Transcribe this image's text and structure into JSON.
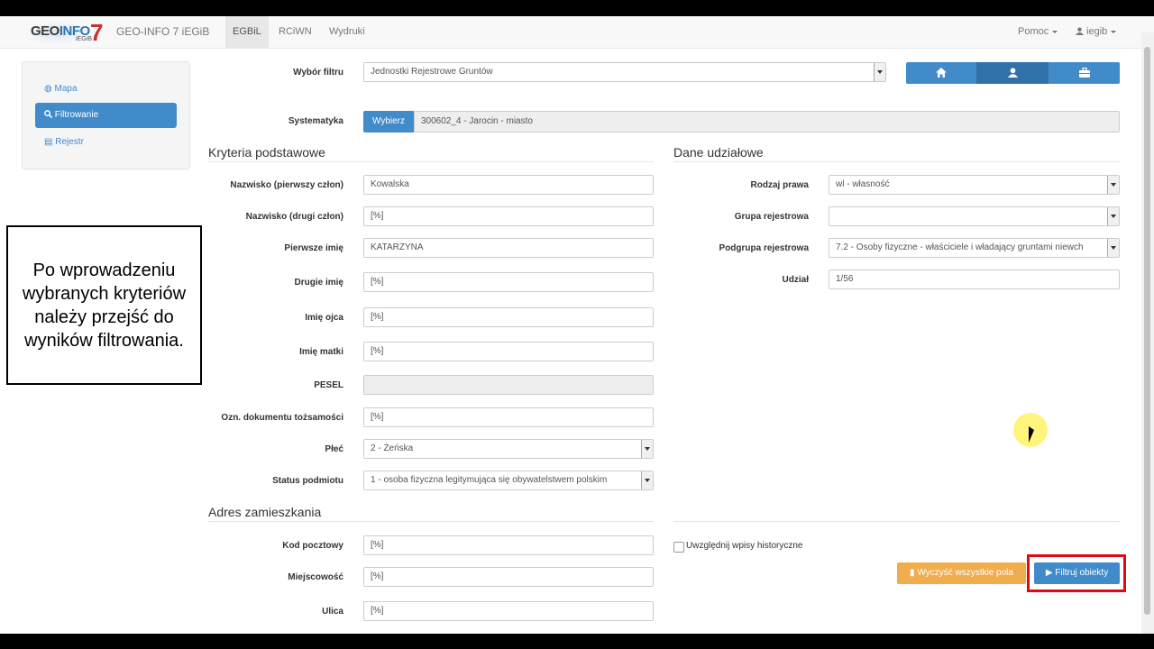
{
  "navbar": {
    "logo_text_geo": "GEO",
    "logo_text_info": "INFO",
    "logo_text_7": "7",
    "logo_text_sub": "iEGiB",
    "brand": "GEO-INFO 7 iEGiB",
    "items": [
      {
        "label": "EGBiL",
        "active": true
      },
      {
        "label": "RCiWN",
        "active": false
      },
      {
        "label": "Wydruki",
        "active": false
      }
    ],
    "help_label": "Pomoc",
    "user_label": "iegib"
  },
  "sidebar": {
    "items": [
      {
        "label": "Mapa",
        "icon": "globe-icon"
      },
      {
        "label": "Filtrowanie",
        "icon": "search-icon",
        "active": true
      },
      {
        "label": "Rejestr",
        "icon": "list-icon"
      }
    ]
  },
  "filter": {
    "label": "Wybór filtru",
    "value": "Jednostki Rejestrowe Gruntów"
  },
  "toolbar": {
    "buttons": [
      {
        "icon": "home-icon"
      },
      {
        "icon": "user-icon",
        "active": true
      },
      {
        "icon": "briefcase-icon"
      }
    ]
  },
  "systematyka": {
    "label": "Systematyka",
    "button": "Wybierz",
    "value": "300602_4 - Jarocin - miasto"
  },
  "kryteria": {
    "title": "Kryteria podstawowe",
    "fields": [
      {
        "label": "Nazwisko (pierwszy człon)",
        "value": "Kowalska"
      },
      {
        "label": "Nazwisko (drugi człon)",
        "value": "[%]"
      },
      {
        "label": "Pierwsze imię",
        "value": "KATARZYNA"
      },
      {
        "label": "Drugie imię",
        "value": "[%]"
      },
      {
        "label": "Imię ojca",
        "value": "[%]"
      },
      {
        "label": "Imię matki",
        "value": "[%]"
      },
      {
        "label": "PESEL",
        "value": ""
      },
      {
        "label": "Ozn. dokumentu tożsamości",
        "value": "[%]"
      },
      {
        "label": "Płeć",
        "value": "2 - Żeńska"
      },
      {
        "label": "Status podmiotu",
        "value": "1 - osoba fizyczna legitymująca się obywatelstwem polskim"
      }
    ]
  },
  "adres": {
    "title": "Adres zamieszkania",
    "fields": [
      {
        "label": "Kod pocztowy",
        "value": "[%]"
      },
      {
        "label": "Miejscowość",
        "value": "[%]"
      },
      {
        "label": "Ulica",
        "value": "[%]"
      }
    ]
  },
  "udzialy": {
    "title": "Dane udziałowe",
    "fields": [
      {
        "label": "Rodzaj prawa",
        "value": "wl - własność"
      },
      {
        "label": "Grupa rejestrowa",
        "value": ""
      },
      {
        "label": "Podgrupa rejestrowa",
        "value": "7.2 - Osoby fizyczne - właściciele i władający gruntami niewch"
      },
      {
        "label": "Udział",
        "value": "1/56"
      }
    ]
  },
  "historyczne_label": "Uwzględnij wpisy historyczne",
  "actions": {
    "clear_label": "Wyczyść wszystkie pola",
    "filter_label": "▶ Filtruj obiekty"
  },
  "annotation": "Po wprowadzeniu wybranych kryteriów należy przejść do wyników filtrowania.",
  "colors": {
    "primary": "#428bca",
    "warning": "#f0ad4e",
    "highlight": "#e30613"
  }
}
